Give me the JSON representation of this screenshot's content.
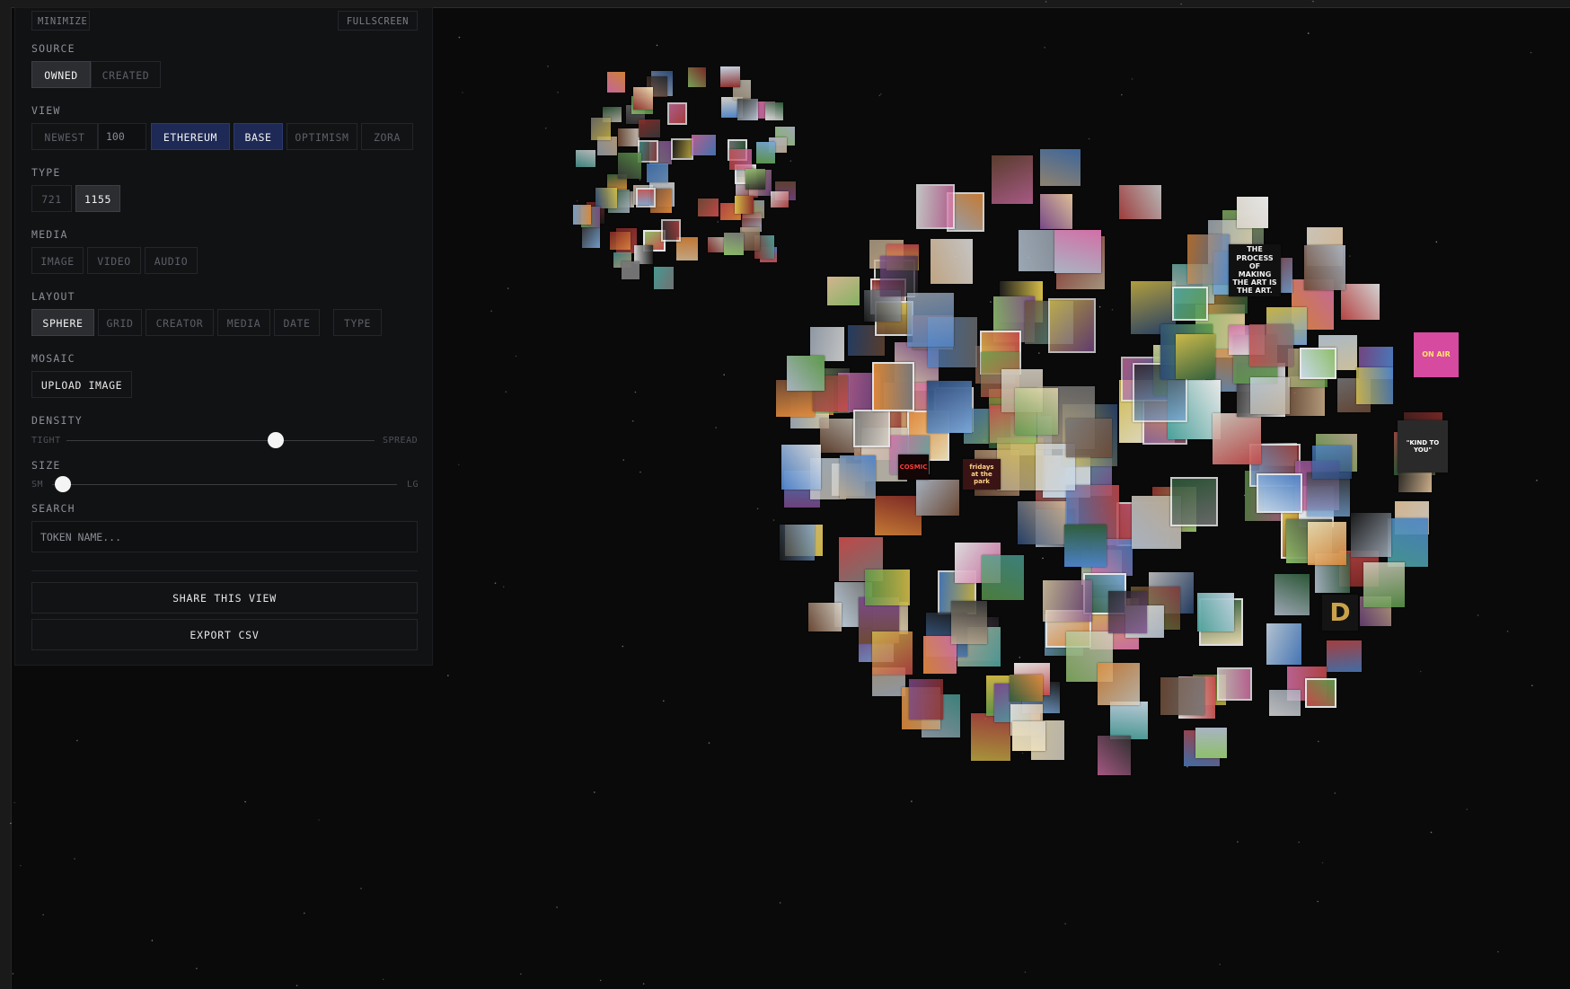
{
  "panel": {
    "minimize_label": "MINIMIZE",
    "fullscreen_label": "FULLSCREEN",
    "source": {
      "label": "SOURCE",
      "owned": "OWNED",
      "created": "CREATED"
    },
    "view": {
      "label": "VIEW",
      "newest": "NEWEST",
      "count_placeholder": "100",
      "ethereum": "ETHEREUM",
      "base": "BASE",
      "optimism": "OPTIMISM",
      "zora": "ZORA"
    },
    "type": {
      "label": "TYPE",
      "erc721": "721",
      "erc1155": "1155"
    },
    "media": {
      "label": "MEDIA",
      "image": "IMAGE",
      "video": "VIDEO",
      "audio": "AUDIO"
    },
    "layout": {
      "label": "LAYOUT",
      "sphere": "SPHERE",
      "grid": "GRID",
      "creator": "CREATOR",
      "media": "MEDIA",
      "date": "DATE",
      "type": "TYPE"
    },
    "mosaic": {
      "label": "MOSAIC",
      "upload": "UPLOAD IMAGE"
    },
    "density": {
      "label": "DENSITY",
      "min": "TIGHT",
      "max": "SPREAD",
      "value": 0.68
    },
    "size": {
      "label": "SIZE",
      "min": "SM",
      "max": "LG",
      "value": 0.03
    },
    "search": {
      "label": "SEARCH",
      "placeholder": "TOKEN NAME..."
    },
    "share_label": "SHARE THIS VIEW",
    "export_label": "EXPORT CSV"
  },
  "selected": {
    "source": "owned",
    "chains": [
      "ethereum",
      "base"
    ],
    "type": "1155",
    "layout": "sphere"
  },
  "colors": {
    "background": "#0a0a0a",
    "panel": "#111214",
    "active": "#2b2d31",
    "active_chain": "#1e2a55",
    "thumb": "#f4f4f4"
  },
  "tile_texts": {
    "process": "THE PROCESS OF MAKING THE ART IS THE ART.",
    "kind": "\"KIND TO YOU\"",
    "onair": "ON AIR",
    "fridays": "fridays at the park",
    "cosmic": "COSMIC",
    "monogram": "D"
  }
}
